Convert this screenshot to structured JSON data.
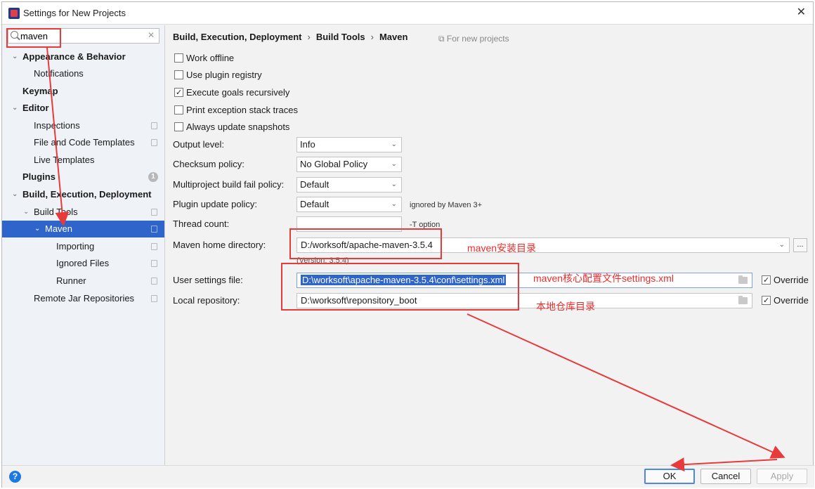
{
  "window": {
    "title": "Settings for New Projects"
  },
  "search": {
    "value": "maven"
  },
  "sidebar": {
    "items": [
      {
        "label": "Appearance & Behavior"
      },
      {
        "label": "Notifications"
      },
      {
        "label": "Keymap"
      },
      {
        "label": "Editor"
      },
      {
        "label": "Inspections"
      },
      {
        "label": "File and Code Templates"
      },
      {
        "label": "Live Templates"
      },
      {
        "label": "Plugins",
        "badge": "1"
      },
      {
        "label": "Build, Execution, Deployment"
      },
      {
        "label": "Build Tools"
      },
      {
        "label": "Maven"
      },
      {
        "label": "Importing"
      },
      {
        "label": "Ignored Files"
      },
      {
        "label": "Runner"
      },
      {
        "label": "Remote Jar Repositories"
      }
    ]
  },
  "breadcrumb": {
    "part1": "Build, Execution, Deployment",
    "sep": "›",
    "part2": "Build Tools",
    "part3": "Maven",
    "scope": "For new projects"
  },
  "checkboxes": {
    "work_offline": "Work offline",
    "use_plugin_registry": "Use plugin registry",
    "execute_goals": "Execute goals recursively",
    "print_exception": "Print exception stack traces",
    "always_update": "Always update snapshots"
  },
  "form": {
    "output_level": {
      "label": "Output level:",
      "value": "Info"
    },
    "checksum_policy": {
      "label": "Checksum policy:",
      "value": "No Global Policy"
    },
    "multiproject_policy": {
      "label": "Multiproject build fail policy:",
      "value": "Default"
    },
    "plugin_update_policy": {
      "label": "Plugin update policy:",
      "value": "Default",
      "hint": "ignored by Maven 3+"
    },
    "thread_count": {
      "label": "Thread count:",
      "value": "",
      "hint": "-T option"
    },
    "maven_home": {
      "label": "Maven home directory:",
      "value": "D:/worksoft/apache-maven-3.5.4",
      "version": "(Version: 3.5.4)",
      "browse": "..."
    },
    "user_settings": {
      "label": "User settings file:",
      "value": "D:\\worksoft\\apache-maven-3.5.4\\conf\\settings.xml",
      "override": "Override"
    },
    "local_repo": {
      "label": "Local repository:",
      "value": "D:\\worksoft\\reponsitory_boot",
      "override": "Override"
    }
  },
  "annotations": {
    "maven_home": "maven安装目录",
    "settings_file": "maven核心配置文件settings.xml",
    "local_repo": "本地仓库目录"
  },
  "buttons": {
    "ok": "OK",
    "cancel": "Cancel",
    "apply": "Apply"
  },
  "colors": {
    "selection": "#2f65ca",
    "annotation": "#e83a3a",
    "help": "#1b79e0"
  }
}
